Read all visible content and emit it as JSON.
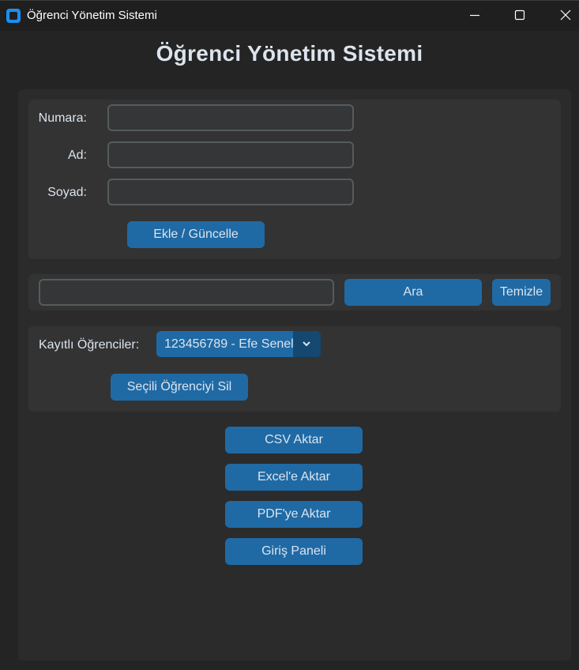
{
  "window": {
    "title": "Öğrenci Yönetim Sistemi",
    "icon": "app-icon",
    "controls": [
      "minimize-icon",
      "maximize-icon",
      "close-icon"
    ]
  },
  "app_title": "Öğrenci Yönetim Sistemi",
  "form": {
    "number_label": "Numara:",
    "number_value": "",
    "name_label": "Ad:",
    "name_value": "",
    "surname_label": "Soyad:",
    "surname_value": "",
    "submit_label": "Ekle / Güncelle"
  },
  "search": {
    "value": "",
    "search_label": "Ara",
    "clear_label": "Temizle"
  },
  "students": {
    "label": "Kayıtlı Öğrenciler:",
    "selected": "123456789 - Efe Senel",
    "delete_label": "Seçili Öğrenciyi Sil"
  },
  "actions": {
    "csv_label": "CSV Aktar",
    "excel_label": "Excel'e Aktar",
    "pdf_label": "PDF'ye Aktar",
    "login_label": "Giriş Paneli"
  },
  "colors": {
    "background": "#242424",
    "panel": "#2b2b2b",
    "frame": "#333333",
    "accent": "#1f6aa5",
    "accent_dark": "#144870",
    "entry_bg": "#343638",
    "entry_border": "#565b5e",
    "text": "#dce4ee"
  }
}
